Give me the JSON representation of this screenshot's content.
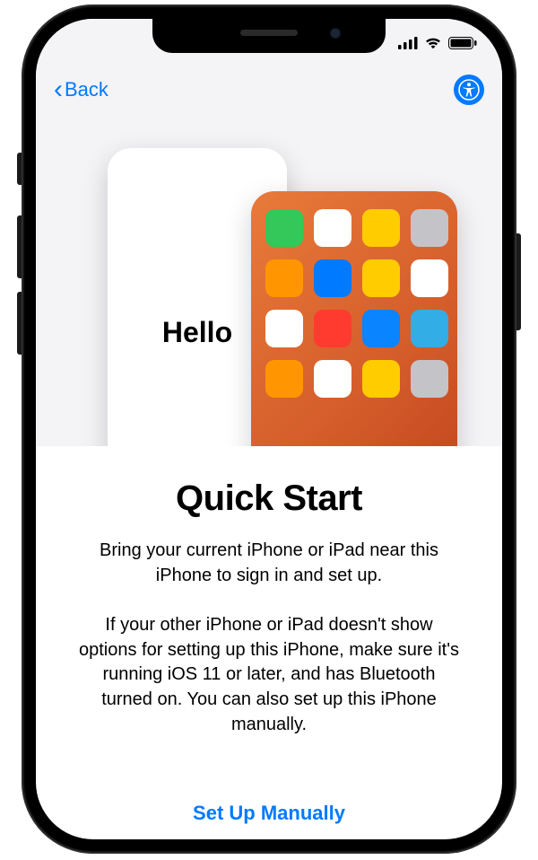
{
  "nav": {
    "back_label": "Back",
    "back_chevron": "‹"
  },
  "hero": {
    "hello_text": "Hello",
    "app_icons": [
      "#34c759",
      "#ffffff",
      "#ffcc00",
      "#c4c4c8",
      "#ff9500",
      "#007aff",
      "#ffcc00",
      "#ffffff",
      "#ffffff",
      "#ff3b30",
      "#0a84ff",
      "#32ade6",
      "#ff9500",
      "#ffffff",
      "#ffcc00",
      "#c4c4c8"
    ]
  },
  "content": {
    "title": "Quick Start",
    "paragraph1": "Bring your current iPhone or iPad near this iPhone to sign in and set up.",
    "paragraph2": "If your other iPhone or iPad doesn't show options for setting up this iPhone, make sure it's running iOS 11 or later, and has Bluetooth turned on. You can also set up this iPhone manually."
  },
  "footer": {
    "setup_manually": "Set Up Manually"
  }
}
